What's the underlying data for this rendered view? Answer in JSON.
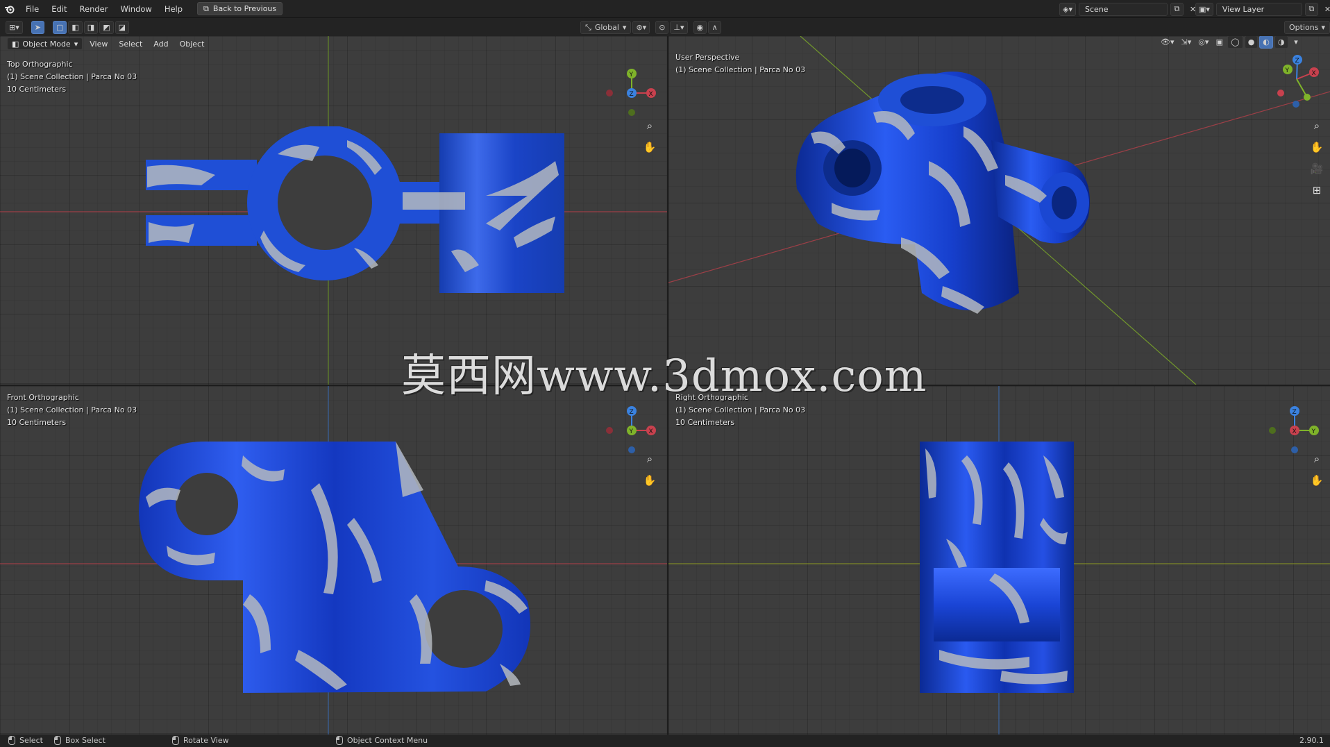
{
  "menu": {
    "items": [
      "File",
      "Edit",
      "Render",
      "Window",
      "Help"
    ],
    "back_label": "Back to Previous"
  },
  "scene": {
    "name": "Scene",
    "view_layer": "View Layer"
  },
  "toolbar": {
    "transform_orientation": "Global",
    "options_label": "Options"
  },
  "viewport_header": {
    "mode": "Object Mode",
    "menus": [
      "View",
      "Select",
      "Add",
      "Object"
    ]
  },
  "viewports": {
    "top": {
      "title": "Top Orthographic",
      "collection": "(1) Scene Collection | Parca No 03",
      "scale": "10 Centimeters"
    },
    "user": {
      "title": "User Perspective",
      "collection": "(1) Scene Collection | Parca No 03"
    },
    "front": {
      "title": "Front Orthographic",
      "collection": "(1) Scene Collection | Parca No 03",
      "scale": "10 Centimeters"
    },
    "right": {
      "title": "Right Orthographic",
      "collection": "(1) Scene Collection | Parca No 03",
      "scale": "10 Centimeters"
    }
  },
  "watermark": "莫西网www.3dmox.com",
  "status": {
    "select": "Select",
    "box_select": "Box Select",
    "rotate_view": "Rotate View",
    "context_menu": "Object Context Menu",
    "version": "2.90.1"
  },
  "colors": {
    "accent": "#4772b3",
    "part_blue": "#1f4fd6",
    "paint_gray": "#b4b8be",
    "axis_x": "#c8414e",
    "axis_y": "#7fb32a",
    "axis_z": "#3a82e0"
  },
  "gizmo_labels": {
    "x": "X",
    "y": "Y",
    "z": "Z"
  }
}
